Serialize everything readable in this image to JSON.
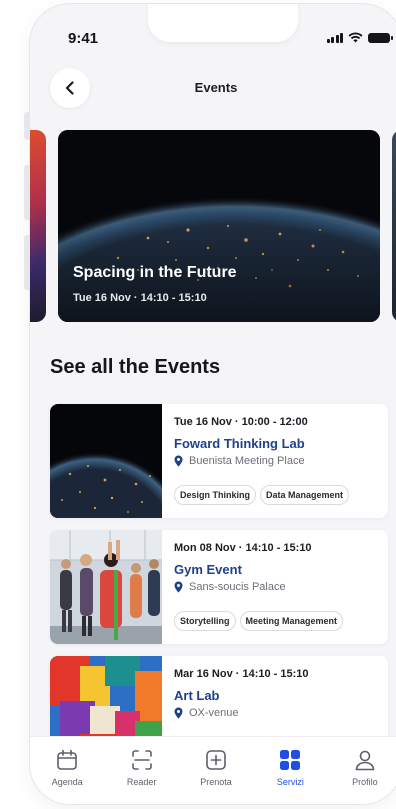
{
  "status_bar": {
    "time": "9:41"
  },
  "header": {
    "title": "Events"
  },
  "hero": {
    "title": "Spacing in the Future",
    "subtitle": "Tue 16 Nov · 14:10 - 15:10"
  },
  "section": {
    "title": "See all the Events"
  },
  "events": [
    {
      "date": "Tue 16 Nov · 10:00 - 12:00",
      "title": "Foward Thinking Lab",
      "location": "Buenista Meeting Place",
      "tags": [
        "Design Thinking",
        "Data Management"
      ],
      "image": "earth-night"
    },
    {
      "date": "Mon 08 Nov · 14:10 - 15:10",
      "title": "Gym Event",
      "location": "Sans-soucis Palace",
      "tags": [
        "Storytelling",
        "Meeting Management"
      ],
      "image": "gym-class"
    },
    {
      "date": "Mar 16 Nov · 14:10 - 15:10",
      "title": "Art Lab",
      "location": "OX-venue",
      "tags": [
        "",
        ""
      ],
      "image": "abstract-painting"
    }
  ],
  "tabbar": {
    "items": [
      {
        "label": "Agenda",
        "icon": "calendar-icon",
        "active": false
      },
      {
        "label": "Reader",
        "icon": "scan-icon",
        "active": false
      },
      {
        "label": "Prenota",
        "icon": "plus-square-icon",
        "active": false
      },
      {
        "label": "Servizi",
        "icon": "grid-icon",
        "active": true
      },
      {
        "label": "Profilo",
        "icon": "user-icon",
        "active": false
      }
    ]
  },
  "colors": {
    "accent": "#1f4ee0",
    "event_title": "#1f3f8f",
    "background": "#f5f5f8"
  }
}
